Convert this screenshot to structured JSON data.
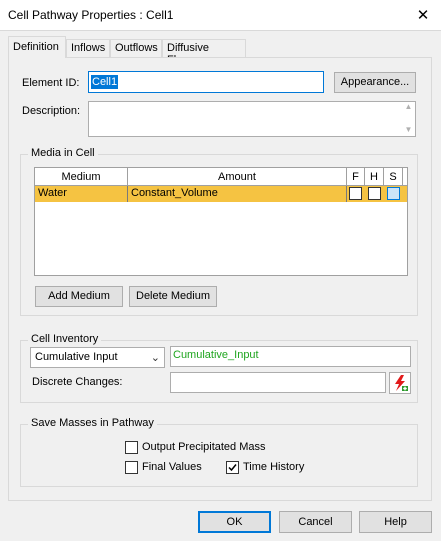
{
  "window": {
    "title": "Cell Pathway Properties : Cell1",
    "close_glyph": "✕"
  },
  "tabs": [
    {
      "label": "Definition",
      "active": true
    },
    {
      "label": "Inflows",
      "active": false
    },
    {
      "label": "Outflows",
      "active": false
    },
    {
      "label": "Diffusive Fluxes",
      "active": false
    }
  ],
  "element": {
    "id_label": "Element ID:",
    "id_value": "Cell1",
    "appearance_label": "Appearance...",
    "description_label": "Description:",
    "description_value": ""
  },
  "media": {
    "group_title": "Media in Cell",
    "columns": {
      "medium": "Medium",
      "amount": "Amount",
      "f": "F",
      "h": "H",
      "s": "S"
    },
    "rows": [
      {
        "medium": "Water",
        "amount": "Constant_Volume",
        "f": false,
        "h": false,
        "s": false
      }
    ],
    "add_label": "Add Medium",
    "delete_label": "Delete Medium"
  },
  "inventory": {
    "group_title": "Cell Inventory",
    "select_value": "Cumulative Input",
    "input_value": "Cumulative_Input",
    "discrete_label": "Discrete Changes:",
    "discrete_value": ""
  },
  "save_masses": {
    "group_title": "Save Masses in Pathway",
    "output_precipitated": {
      "label": "Output Precipitated Mass",
      "checked": false
    },
    "final_values": {
      "label": "Final Values",
      "checked": false
    },
    "time_history": {
      "label": "Time History",
      "checked": true
    }
  },
  "buttons": {
    "ok": "OK",
    "cancel": "Cancel",
    "help": "Help"
  },
  "colors": {
    "selection": "#f5c342",
    "link_green": "#1fa51f",
    "accent_blue": "#0078d7"
  }
}
